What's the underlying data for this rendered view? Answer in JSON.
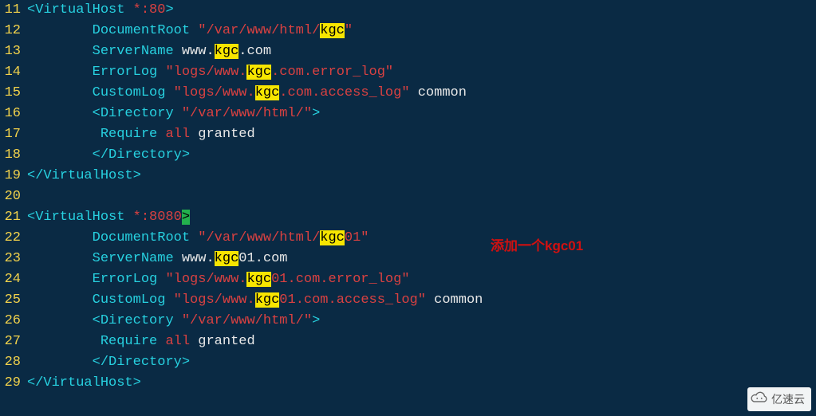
{
  "lines": [
    {
      "n": 11,
      "t": [
        {
          "c": "angle",
          "v": "<"
        },
        {
          "c": "tag",
          "v": "VirtualHost"
        },
        {
          "c": "plain",
          "v": " "
        },
        {
          "c": "attr",
          "v": "*:80"
        },
        {
          "c": "angle",
          "v": ">"
        }
      ]
    },
    {
      "n": 12,
      "t": [
        {
          "c": "plain",
          "v": "        "
        },
        {
          "c": "kwcyan",
          "v": "DocumentRoot"
        },
        {
          "c": "plain",
          "v": " "
        },
        {
          "c": "str",
          "v": "\"/var/www/html/"
        },
        {
          "c": "hl",
          "v": "kgc"
        },
        {
          "c": "str",
          "v": "\""
        }
      ]
    },
    {
      "n": 13,
      "t": [
        {
          "c": "plain",
          "v": "        "
        },
        {
          "c": "kwcyan",
          "v": "ServerName"
        },
        {
          "c": "plain",
          "v": " www."
        },
        {
          "c": "hl",
          "v": "kgc"
        },
        {
          "c": "plain",
          "v": ".com"
        }
      ]
    },
    {
      "n": 14,
      "t": [
        {
          "c": "plain",
          "v": "        "
        },
        {
          "c": "kwcyan",
          "v": "ErrorLog"
        },
        {
          "c": "plain",
          "v": " "
        },
        {
          "c": "str",
          "v": "\"logs/www."
        },
        {
          "c": "hl",
          "v": "kgc"
        },
        {
          "c": "str",
          "v": ".com.error_log\""
        }
      ]
    },
    {
      "n": 15,
      "t": [
        {
          "c": "plain",
          "v": "        "
        },
        {
          "c": "kwcyan",
          "v": "CustomLog"
        },
        {
          "c": "plain",
          "v": " "
        },
        {
          "c": "str",
          "v": "\"logs/www."
        },
        {
          "c": "hl",
          "v": "kgc"
        },
        {
          "c": "str",
          "v": ".com.access_log\""
        },
        {
          "c": "plain",
          "v": " common"
        }
      ]
    },
    {
      "n": 16,
      "t": [
        {
          "c": "plain",
          "v": "        "
        },
        {
          "c": "angle",
          "v": "<"
        },
        {
          "c": "tag",
          "v": "Directory"
        },
        {
          "c": "plain",
          "v": " "
        },
        {
          "c": "str",
          "v": "\"/var/www/html/\""
        },
        {
          "c": "angle",
          "v": ">"
        }
      ]
    },
    {
      "n": 17,
      "t": [
        {
          "c": "plain",
          "v": "         "
        },
        {
          "c": "kwcyan",
          "v": "Require"
        },
        {
          "c": "plain",
          "v": " "
        },
        {
          "c": "str",
          "v": "all"
        },
        {
          "c": "plain",
          "v": " granted"
        }
      ]
    },
    {
      "n": 18,
      "t": [
        {
          "c": "plain",
          "v": "        "
        },
        {
          "c": "angle",
          "v": "</"
        },
        {
          "c": "tag",
          "v": "Directory"
        },
        {
          "c": "angle",
          "v": ">"
        }
      ]
    },
    {
      "n": 19,
      "t": [
        {
          "c": "angle",
          "v": "</"
        },
        {
          "c": "tag",
          "v": "VirtualHost"
        },
        {
          "c": "angle",
          "v": ">"
        }
      ]
    },
    {
      "n": 20,
      "t": []
    },
    {
      "n": 21,
      "t": [
        {
          "c": "angle",
          "v": "<"
        },
        {
          "c": "tag",
          "v": "VirtualHost"
        },
        {
          "c": "plain",
          "v": " "
        },
        {
          "c": "attr",
          "v": "*:8080"
        },
        {
          "c": "cursor",
          "v": ">"
        }
      ]
    },
    {
      "n": 22,
      "t": [
        {
          "c": "plain",
          "v": "        "
        },
        {
          "c": "kwcyan",
          "v": "DocumentRoot"
        },
        {
          "c": "plain",
          "v": " "
        },
        {
          "c": "str",
          "v": "\"/var/www/html/"
        },
        {
          "c": "hl",
          "v": "kgc"
        },
        {
          "c": "str",
          "v": "01\""
        }
      ]
    },
    {
      "n": 23,
      "t": [
        {
          "c": "plain",
          "v": "        "
        },
        {
          "c": "kwcyan",
          "v": "ServerName"
        },
        {
          "c": "plain",
          "v": " www."
        },
        {
          "c": "hl",
          "v": "kgc"
        },
        {
          "c": "plain",
          "v": "01.com"
        }
      ]
    },
    {
      "n": 24,
      "t": [
        {
          "c": "plain",
          "v": "        "
        },
        {
          "c": "kwcyan",
          "v": "ErrorLog"
        },
        {
          "c": "plain",
          "v": " "
        },
        {
          "c": "str",
          "v": "\"logs/www."
        },
        {
          "c": "hl",
          "v": "kgc"
        },
        {
          "c": "str",
          "v": "01.com.error_log\""
        }
      ]
    },
    {
      "n": 25,
      "t": [
        {
          "c": "plain",
          "v": "        "
        },
        {
          "c": "kwcyan",
          "v": "CustomLog"
        },
        {
          "c": "plain",
          "v": " "
        },
        {
          "c": "str",
          "v": "\"logs/www."
        },
        {
          "c": "hl",
          "v": "kgc"
        },
        {
          "c": "str",
          "v": "01.com.access_log\""
        },
        {
          "c": "plain",
          "v": " common"
        }
      ]
    },
    {
      "n": 26,
      "t": [
        {
          "c": "plain",
          "v": "        "
        },
        {
          "c": "angle",
          "v": "<"
        },
        {
          "c": "tag",
          "v": "Directory"
        },
        {
          "c": "plain",
          "v": " "
        },
        {
          "c": "str",
          "v": "\"/var/www/html/\""
        },
        {
          "c": "angle",
          "v": ">"
        }
      ]
    },
    {
      "n": 27,
      "t": [
        {
          "c": "plain",
          "v": "         "
        },
        {
          "c": "kwcyan",
          "v": "Require"
        },
        {
          "c": "plain",
          "v": " "
        },
        {
          "c": "str",
          "v": "all"
        },
        {
          "c": "plain",
          "v": " granted"
        }
      ]
    },
    {
      "n": 28,
      "t": [
        {
          "c": "plain",
          "v": "        "
        },
        {
          "c": "angle",
          "v": "</"
        },
        {
          "c": "tag",
          "v": "Directory"
        },
        {
          "c": "angle",
          "v": ">"
        }
      ]
    },
    {
      "n": 29,
      "t": [
        {
          "c": "angle",
          "v": "</"
        },
        {
          "c": "tag",
          "v": "VirtualHost"
        },
        {
          "c": "angle",
          "v": ">"
        }
      ]
    }
  ],
  "annotation": {
    "prefix": "添加一个",
    "bold": "kgc01"
  },
  "watermark": "亿速云"
}
